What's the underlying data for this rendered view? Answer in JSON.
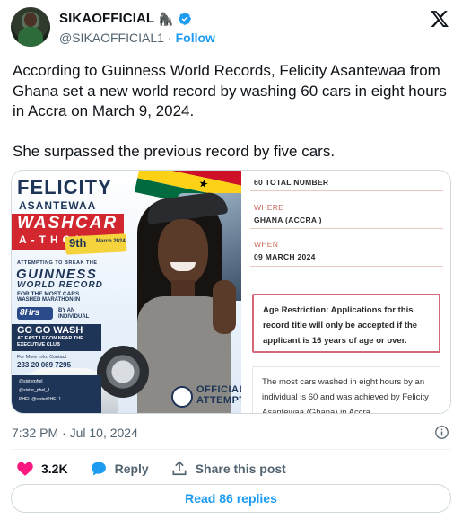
{
  "author": {
    "display_name": "SIKAOFFICIAL",
    "name_emoji": "🦍",
    "handle": "@SIKAOFFICIAL1",
    "separator": "·",
    "follow_label": "Follow"
  },
  "tweet": {
    "paragraphs": [
      "According to Guinness World Records, Felicity Asantewaa from Ghana set a new world record by washing 60 cars in eight hours in Accra on March 9, 2024.",
      "She surpassed the previous record by five cars."
    ],
    "timestamp": "7:32 PM · Jul 10, 2024"
  },
  "media": {
    "poster": {
      "title_line1": "FELICITY",
      "title_line2": "ASANTEWAA",
      "washcar": "WASHCAR",
      "athon": "A-THON",
      "edition": "9th",
      "edition_sub": "March 2024",
      "attempt_line": "ATTEMPTING TO BREAK THE",
      "guinness": "GUINNESS",
      "world_record": "WORLD RECORD",
      "most_cars_line1": "FOR THE MOST CARS",
      "most_cars_line2": "WASHED MARATHON IN",
      "hours": "8Hrs",
      "individual": "BY AN INDIVIDUAL",
      "gogo_wash": "GO GO WASH",
      "gogo_sub": "AT EAST LEGON NEAR THE EXECUTIVE CLUB",
      "more_info": "For More Info. Contact",
      "phone": "233 20 069 7295",
      "socials": [
        "@sisterphel",
        "@sister_phel_1",
        "PHEL @sisterPHEL1"
      ],
      "official_line1": "OFFICIAL",
      "official_line2": "ATTEMPT"
    },
    "record": {
      "total_value": "60 TOTAL NUMBER",
      "where_label": "WHERE",
      "where_value": "GHANA (ACCRA )",
      "when_label": "WHEN",
      "when_value": "09 MARCH 2024",
      "restriction": "Age Restriction: Applications for this record title will only be accepted if the applicant is 16 years of age or over.",
      "summary": "The most cars washed in eight hours by an individual is 60 and was achieved by Felicity Asantewaa (Ghana) in Accra"
    }
  },
  "engagement": {
    "likes_count": "3.2K",
    "reply_label": "Reply",
    "share_label": "Share this post",
    "read_replies_label": "Read 86 replies"
  },
  "colors": {
    "link_blue": "#1d9bf0",
    "like_red": "#f91880",
    "secondary_text": "#536471"
  }
}
